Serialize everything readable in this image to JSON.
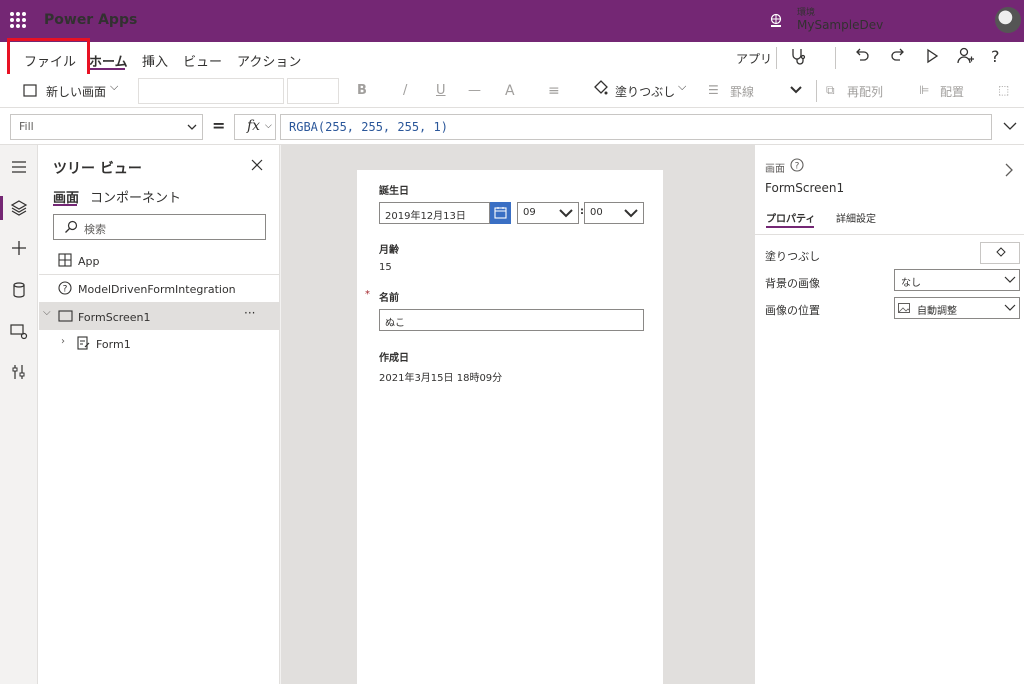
{
  "app": {
    "title": "Power Apps",
    "env_label": "環境",
    "env_name": "MySampleDev"
  },
  "menu": {
    "file": "ファイル",
    "home": "ホーム",
    "insert": "挿入",
    "view": "ビュー",
    "action": "アクション",
    "app_btn": "アプリ",
    "help": "?"
  },
  "toolbar": {
    "new_screen": "新しい画面",
    "bold": "B",
    "italic": "/",
    "underline": "U",
    "strike": "—",
    "font_color": "A",
    "fill": "塗りつぶし",
    "border": "罫線",
    "reorder": "再配列",
    "align": "配置"
  },
  "formula": {
    "property": "Fill",
    "equals": "=",
    "fx": "fx",
    "value": "RGBA(255, 255, 255, 1)"
  },
  "tree": {
    "title": "ツリー ビュー",
    "tab_screens": "画面",
    "tab_components": "コンポーネント",
    "search_placeholder": "検索",
    "items": [
      {
        "label": "App"
      },
      {
        "label": "ModelDrivenFormIntegration"
      },
      {
        "label": "FormScreen1",
        "more": "···"
      },
      {
        "label": "Form1"
      }
    ]
  },
  "form": {
    "birthday_label": "誕生日",
    "birthday_date": "2019年12月13日",
    "hour": "09",
    "minute": "00",
    "colon": ":",
    "age_label": "月齢",
    "age_value": "15",
    "required_mark": "*",
    "name_label": "名前",
    "name_value": "ぬこ",
    "created_label": "作成日",
    "created_value": "2021年3月15日 18時09分"
  },
  "props": {
    "section": "画面",
    "screen_name": "FormScreen1",
    "tab_properties": "プロパティ",
    "tab_advanced": "詳細設定",
    "fill_label": "塗りつぶし",
    "bg_image_label": "背景の画像",
    "bg_image_value": "なし",
    "image_pos_label": "画像の位置",
    "image_pos_value": "自動調整"
  },
  "colors": {
    "brand": "#742774",
    "highlight": "#e81123",
    "accent_blue": "#2b579a"
  }
}
